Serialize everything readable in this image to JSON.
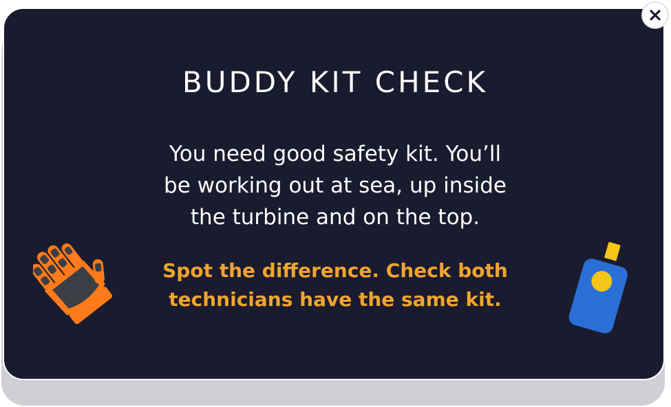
{
  "dialog": {
    "title": "BUDDY KIT CHECK",
    "body_lines": [
      "You need good safety kit. You’ll",
      "be working out at sea, up inside",
      "the turbine and on the top."
    ],
    "highlight_lines": [
      "Spot the difference. Check both",
      "technicians have the same kit."
    ]
  },
  "icons": {
    "close": "close-icon",
    "glove": "safety-glove-icon",
    "bottle": "sunscreen-bottle-icon"
  },
  "colors": {
    "card_background": "#1a1b2e",
    "title_text": "#ffffff",
    "highlight_text": "#f0a431",
    "glove_orange": "#ff7a1a",
    "glove_grey": "#3b3f45",
    "bottle_blue": "#2a6fd6",
    "bottle_yellow": "#f5c518"
  }
}
